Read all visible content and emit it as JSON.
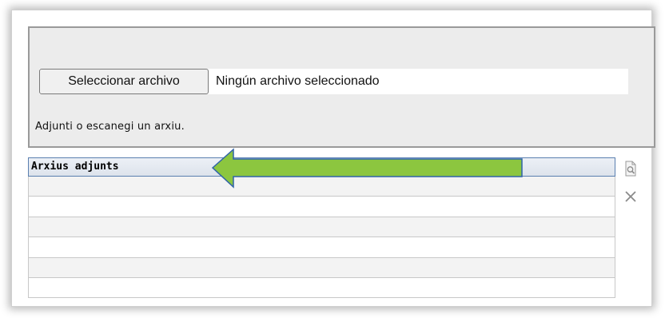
{
  "upload": {
    "choose_button_label": "Seleccionar archivo",
    "file_status": "Ningún archivo seleccionado",
    "hint": "Adjunti o escanegi un arxiu."
  },
  "attachments": {
    "header": "Arxius adjunts",
    "rows": [
      "",
      "",
      "",
      "",
      "",
      ""
    ]
  },
  "toolbar": {
    "view_icon": "view-document-icon",
    "delete_icon": "delete-x-icon"
  },
  "annotation": {
    "arrow_color": "#8cc63f",
    "arrow_outline": "#2f63a8"
  },
  "colors": {
    "panel_background": "#ececec",
    "header_border": "#5a7fb0"
  }
}
